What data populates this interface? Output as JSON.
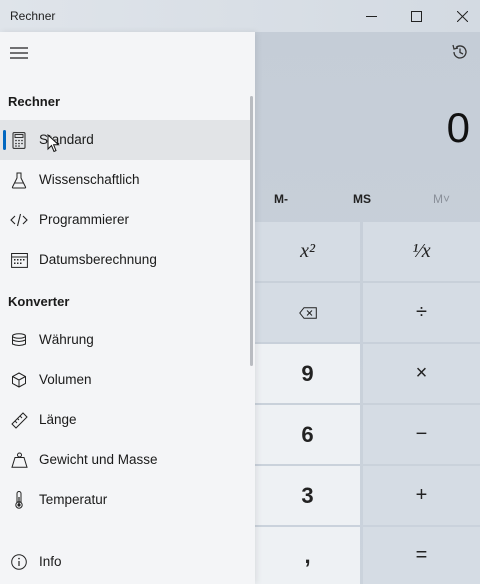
{
  "window": {
    "title": "Rechner"
  },
  "display": {
    "value": "0"
  },
  "memory": {
    "m_minus": "M-",
    "ms": "MS",
    "m_view": "M˅"
  },
  "keys": {
    "square_label": "x²",
    "reciprocal_label": "¹⁄x",
    "divide_label": "÷",
    "nine": "9",
    "multiply_label": "×",
    "six": "6",
    "minus_label": "−",
    "three": "3",
    "plus_label": "+",
    "comma": ",",
    "equals_label": "="
  },
  "nav": {
    "section_calculators": "Rechner",
    "section_converters": "Konverter",
    "items": [
      {
        "label": "Standard",
        "icon": "calculator-icon",
        "selected": true
      },
      {
        "label": "Wissenschaftlich",
        "icon": "flask-icon"
      },
      {
        "label": "Programmierer",
        "icon": "code-icon"
      },
      {
        "label": "Datumsberechnung",
        "icon": "calendar-icon"
      },
      {
        "label": "Währung",
        "icon": "coins-icon"
      },
      {
        "label": "Volumen",
        "icon": "cube-icon"
      },
      {
        "label": "Länge",
        "icon": "ruler-icon"
      },
      {
        "label": "Gewicht und Masse",
        "icon": "weight-icon"
      },
      {
        "label": "Temperatur",
        "icon": "thermometer-icon"
      },
      {
        "label": "Info",
        "icon": "info-icon"
      }
    ]
  },
  "colors": {
    "accent": "#0067c0",
    "nav_bg": "#f4f5f7",
    "calc_bg": "#c6ced8"
  }
}
